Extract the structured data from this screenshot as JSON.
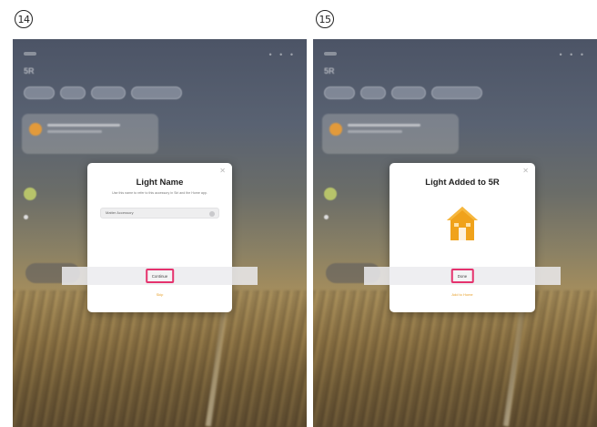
{
  "steps": [
    {
      "number": "14",
      "dialog": {
        "title": "Light Name",
        "subtitle": "Use this name to refer to this accessory in Siri and the Home app.",
        "name_field_value": "Matter Accessory",
        "primary_button": "Continue",
        "link": "Skip"
      }
    },
    {
      "number": "15",
      "dialog": {
        "title": "Light Added to 5R",
        "primary_button": "Done",
        "link": "Add to Home",
        "icon": "house-icon"
      }
    }
  ],
  "background": {
    "home_title": "5R",
    "status_dots": "• • •"
  },
  "colors": {
    "highlight": "#e5326d",
    "accent": "#e8a22e",
    "house": "#f0a21b"
  }
}
